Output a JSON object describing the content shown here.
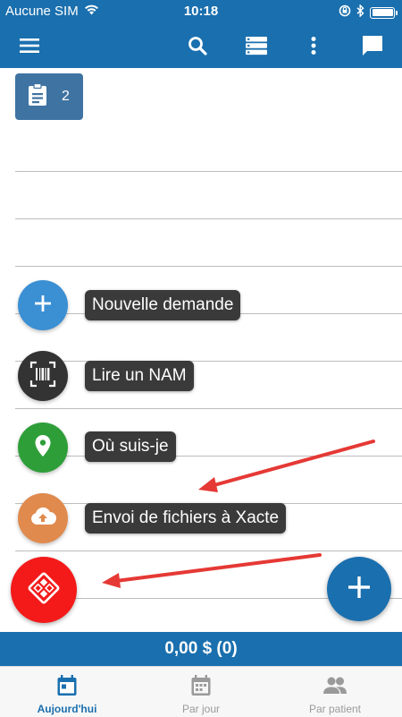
{
  "status_bar": {
    "carrier": "Aucune SIM",
    "time": "10:18"
  },
  "header": {
    "icons": [
      "menu-icon",
      "search-icon",
      "list-view-icon",
      "more-vert-icon",
      "chat-icon"
    ]
  },
  "badge": {
    "count": "2",
    "icon": "clipboard-icon"
  },
  "speed_dial": {
    "items": [
      {
        "label": "Nouvelle demande",
        "icon": "plus-icon",
        "color": "#3b8fd3"
      },
      {
        "label": "Lire un NAM",
        "icon": "barcode-icon",
        "color": "#333333"
      },
      {
        "label": "Où suis-je",
        "icon": "location-pin-icon",
        "color": "#2e9e39"
      },
      {
        "label": "Envoi de fichiers à Xacte",
        "icon": "cloud-upload-icon",
        "color": "#e08a4d"
      }
    ],
    "red_fab": {
      "icon": "xacte-logo-icon",
      "color": "#f41a1a"
    },
    "main_fab": {
      "icon": "plus-icon",
      "color": "#1a6fae"
    }
  },
  "total_bar": {
    "text": "0,00 $ (0)"
  },
  "tabs": [
    {
      "label": "Aujourd'hui",
      "icon": "calendar-today-icon",
      "active": true
    },
    {
      "label": "Par jour",
      "icon": "calendar-icon",
      "active": false
    },
    {
      "label": "Par patient",
      "icon": "people-icon",
      "active": false
    }
  ],
  "colors": {
    "primary": "#1a6fae",
    "badge": "#3f73a2",
    "label_bg": "#3a3a3a",
    "arrow": "#e53935"
  }
}
